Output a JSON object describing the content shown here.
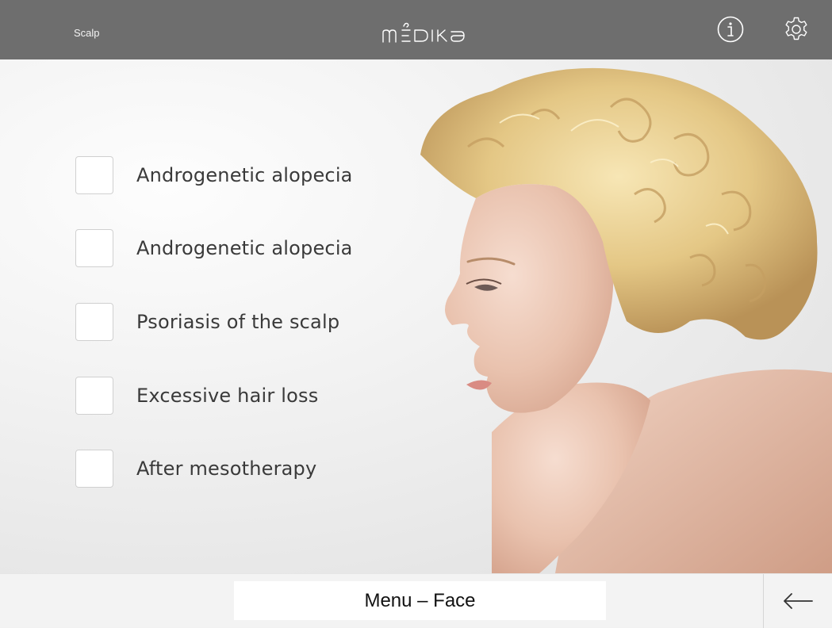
{
  "header": {
    "section_title": "Scalp",
    "brand": "mEDIKA",
    "icons": {
      "info": "info-circle-icon",
      "settings": "gear-icon"
    },
    "background_color": "#6e6e6e"
  },
  "options": [
    {
      "label": "Androgenetic alopecia",
      "checked": false
    },
    {
      "label": "Androgenetic alopecia",
      "checked": false
    },
    {
      "label": "Psoriasis of the scalp",
      "checked": false
    },
    {
      "label": "Excessive hair loss",
      "checked": false
    },
    {
      "label": "After mesotherapy",
      "checked": false
    }
  ],
  "footer": {
    "menu_label": "Menu – Face",
    "back_icon": "arrow-left-icon"
  }
}
